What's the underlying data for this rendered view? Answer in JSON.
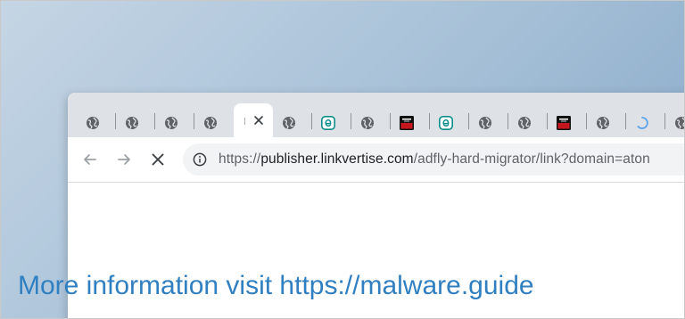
{
  "tabs": [
    {
      "favicon": "globe-icon"
    },
    {
      "favicon": "globe-icon"
    },
    {
      "favicon": "globe-icon"
    },
    {
      "favicon": "globe-icon"
    },
    {
      "favicon": "loading-icon",
      "active": true
    },
    {
      "favicon": "globe-icon"
    },
    {
      "favicon": "eset-e-icon"
    },
    {
      "favicon": "globe-icon"
    },
    {
      "favicon": "red-app-icon"
    },
    {
      "favicon": "eset-e-icon"
    },
    {
      "favicon": "globe-icon"
    },
    {
      "favicon": "globe-icon"
    },
    {
      "favicon": "red-app-icon"
    },
    {
      "favicon": "globe-icon"
    },
    {
      "favicon": "spinner-icon"
    },
    {
      "favicon": "globe-icon"
    }
  ],
  "toolbar": {
    "back_icon": "back-arrow-icon",
    "forward_icon": "forward-arrow-icon",
    "stop_icon": "stop-x-icon"
  },
  "address_bar": {
    "scheme": "https://",
    "host": "publisher.linkvertise.com",
    "path": "/adfly-hard-migrator/link?domain=aton"
  },
  "watermark": {
    "text": "More information visit https://malware.guide"
  },
  "colors": {
    "tabstrip": "#dee1e6",
    "omnibox": "#f1f3f4",
    "eset_teal": "#0e8e8a",
    "red_app": "#c6161d",
    "watermark": "#2f7fc1",
    "spinner": "#5aa3e8"
  }
}
